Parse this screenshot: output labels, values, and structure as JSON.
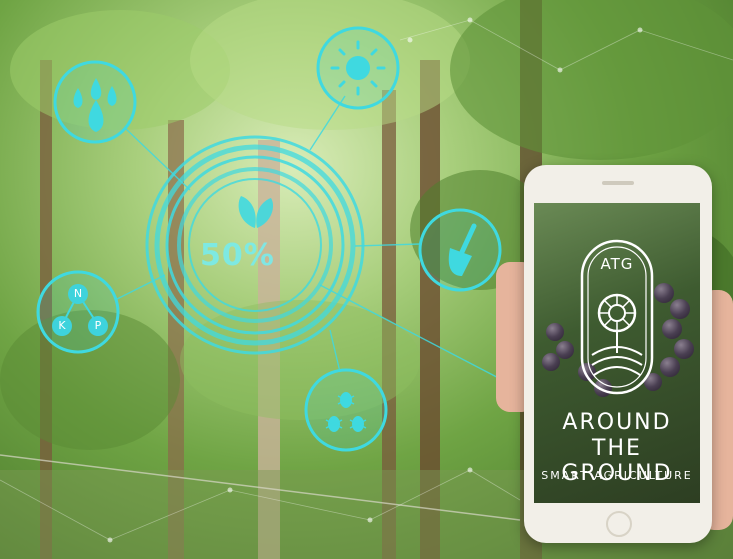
{
  "overlay": {
    "gauge_value": "50%",
    "npk_labels": [
      "N",
      "K",
      "P"
    ],
    "icons": [
      "water-drops-icon",
      "sun-icon",
      "shovel-icon",
      "bug-icon",
      "leaf-icon",
      "nutrients-icon"
    ]
  },
  "phone": {
    "logo_letters": "ATG",
    "title_line1": "AROUND",
    "title_line2": "THE GROUND",
    "subtitle": "SMART AGRICULTURE"
  },
  "colors": {
    "hud_cyan": "#3fd9e0",
    "foliage_green": "#6fa444",
    "phone_frame": "#f2efe8"
  }
}
